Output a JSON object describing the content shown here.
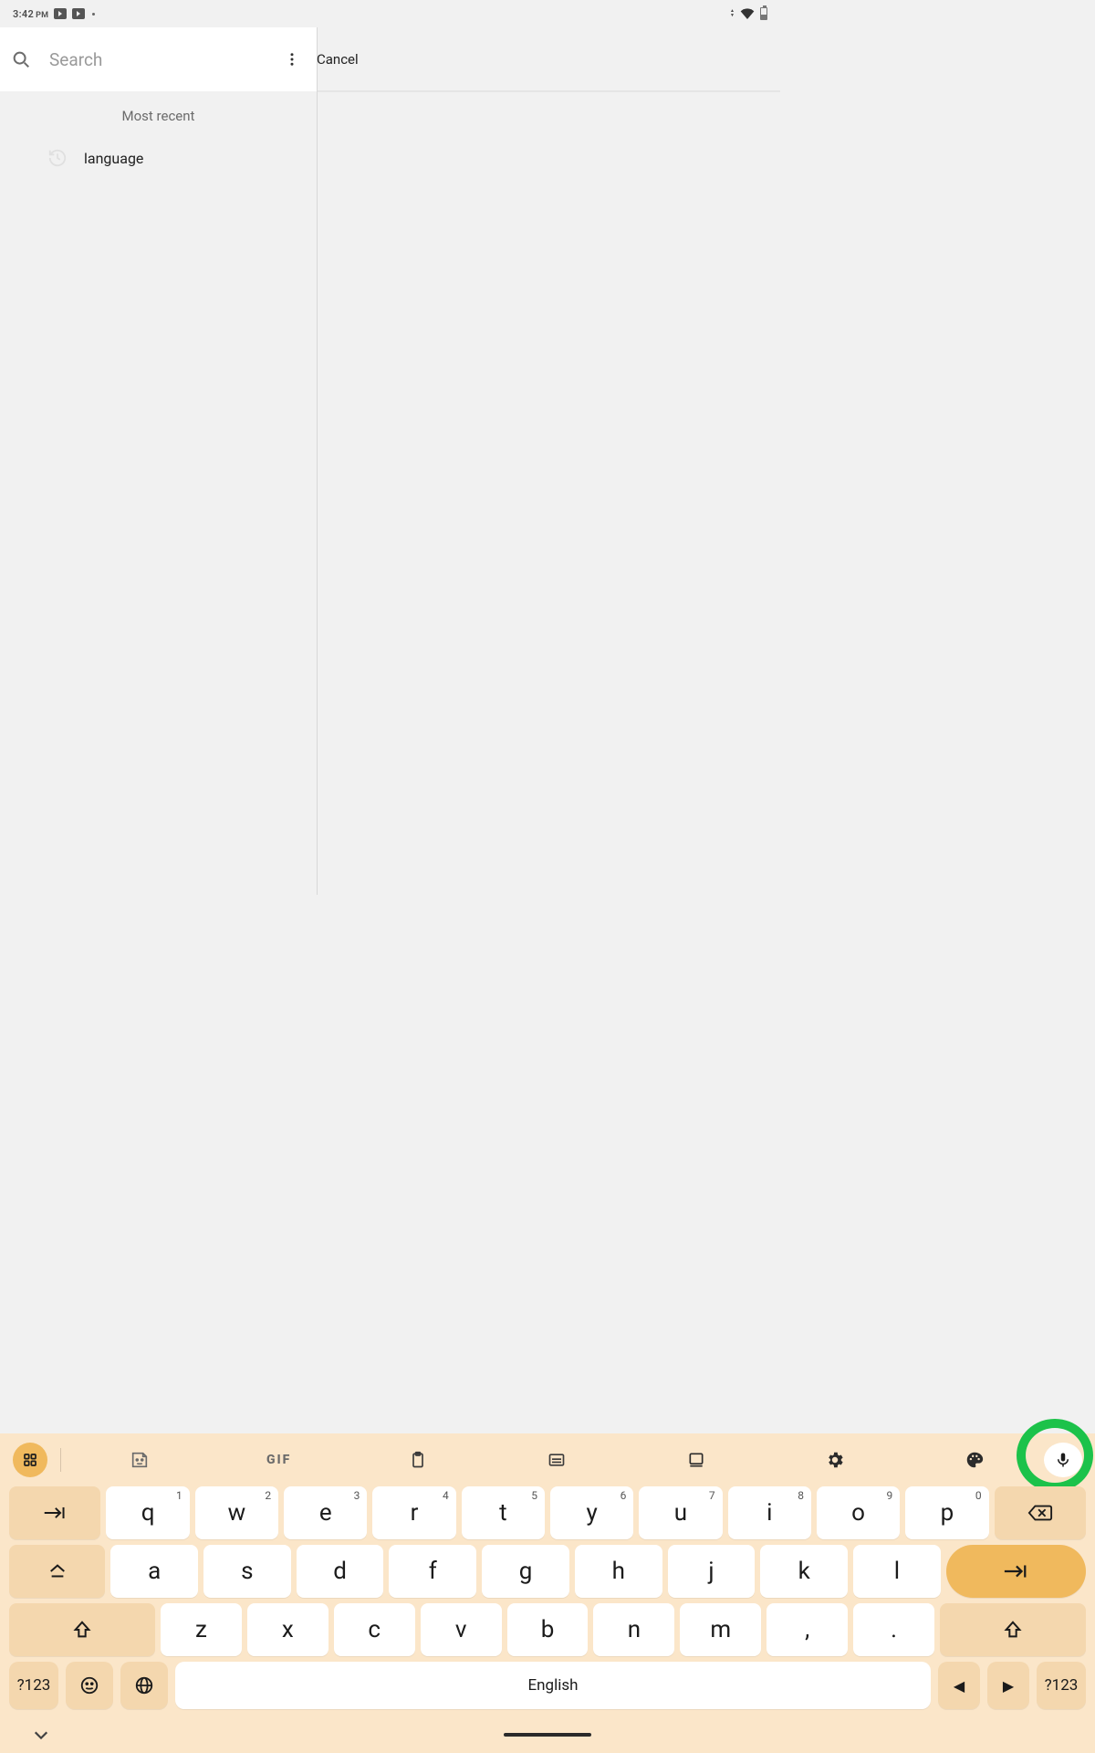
{
  "statusbar": {
    "time": "3:42",
    "ampm": "PM"
  },
  "search": {
    "placeholder": "Search",
    "cancel_label": "Cancel",
    "value": ""
  },
  "recent": {
    "header": "Most recent",
    "items": [
      "language"
    ]
  },
  "keyboard": {
    "toolbar": {
      "gif_label": "GIF"
    },
    "row1": [
      {
        "k": "q",
        "n": "1"
      },
      {
        "k": "w",
        "n": "2"
      },
      {
        "k": "e",
        "n": "3"
      },
      {
        "k": "r",
        "n": "4"
      },
      {
        "k": "t",
        "n": "5"
      },
      {
        "k": "y",
        "n": "6"
      },
      {
        "k": "u",
        "n": "7"
      },
      {
        "k": "i",
        "n": "8"
      },
      {
        "k": "o",
        "n": "9"
      },
      {
        "k": "p",
        "n": "0"
      }
    ],
    "row2": [
      "a",
      "s",
      "d",
      "f",
      "g",
      "h",
      "j",
      "k",
      "l"
    ],
    "row3": [
      "z",
      "x",
      "c",
      "v",
      "b",
      "n",
      "m",
      ",",
      "."
    ],
    "sym_label": "?123",
    "space_label": "English"
  }
}
